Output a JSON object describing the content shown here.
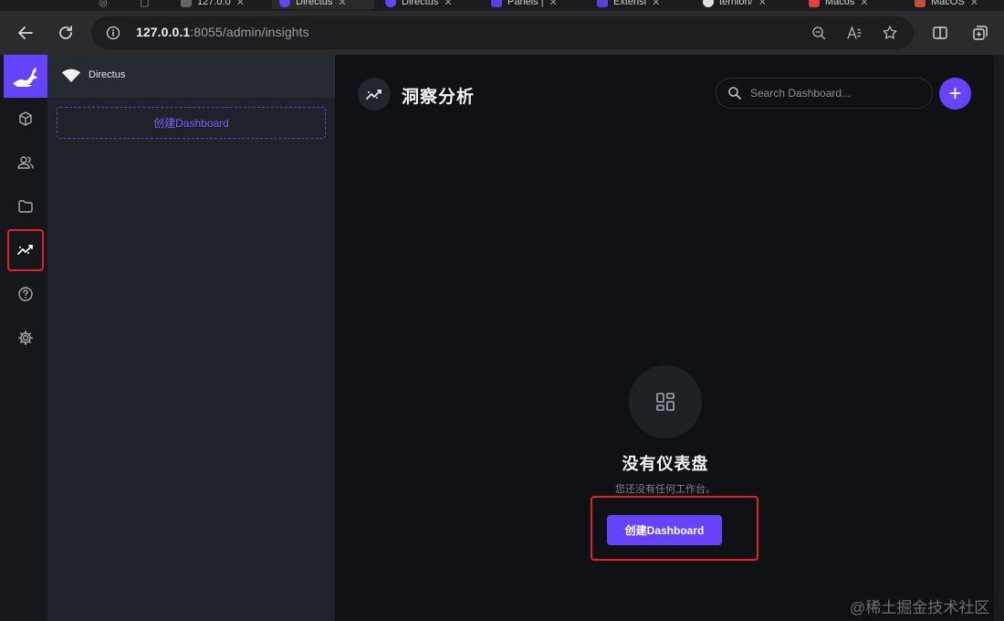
{
  "browser": {
    "tabs": [
      {
        "label": "127.0.0",
        "color": "#555"
      },
      {
        "label": "Directus",
        "color": "#6644ff"
      },
      {
        "label": "Directus",
        "color": "#6644ff"
      },
      {
        "label": "Panels |",
        "color": "#5a3fe0"
      },
      {
        "label": "Extensi",
        "color": "#5a3fe0"
      },
      {
        "label": "ternion/",
        "color": "#ddd"
      },
      {
        "label": "Macos",
        "color": "#e04040"
      },
      {
        "label": "MacOS",
        "color": "#c0503a"
      }
    ],
    "url_host": "127.0.0.1",
    "url_path": ":8055/admin/insights"
  },
  "sidebar": {
    "project_name": "Directus",
    "create_button": "创建Dashboard"
  },
  "header": {
    "title": "洞察分析",
    "search_placeholder": "Search Dashboard..."
  },
  "empty_state": {
    "title": "没有仪表盘",
    "subtitle": "您还没有任何工作台。",
    "button": "创建Dashboard"
  },
  "watermark": "@稀土掘金技术社区",
  "colors": {
    "accent": "#6644ff",
    "highlight": "#e0202a"
  }
}
